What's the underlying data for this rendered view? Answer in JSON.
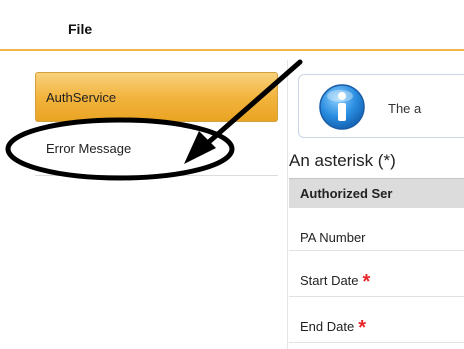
{
  "menu": {
    "file_label": "File"
  },
  "sidebar": {
    "items": [
      {
        "label": "AuthService",
        "active": true
      },
      {
        "label": "Error Message",
        "active": false
      }
    ]
  },
  "info": {
    "text": "The a"
  },
  "note": {
    "text": "An asterisk (*)"
  },
  "section": {
    "title": "Authorized Ser"
  },
  "fields": [
    {
      "label": "PA Number",
      "required": false
    },
    {
      "label": "Start Date",
      "required": true
    },
    {
      "label": "End Date",
      "required": true
    }
  ],
  "required_marker": "*",
  "colors": {
    "accent": "#f2b43e",
    "menu_border": "#f0b54a",
    "required": "#e8262a",
    "info_blue": "#1f7fd1"
  }
}
